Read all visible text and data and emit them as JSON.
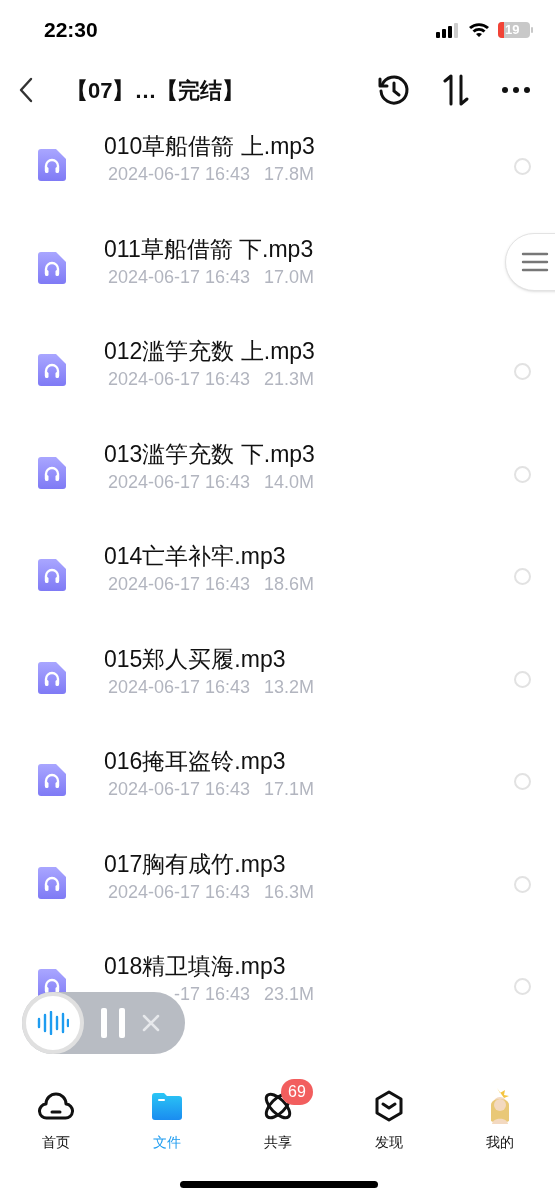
{
  "status_bar": {
    "time": "22:30",
    "battery": "19"
  },
  "header": {
    "title": "【07】…【完结】"
  },
  "files": [
    {
      "name": "010草船借箭 上.mp3",
      "date": "2024-06-17 16:43",
      "size": "17.8M",
      "selected": false
    },
    {
      "name": "011草船借箭 下.mp3",
      "date": "2024-06-17 16:43",
      "size": "17.0M"
    },
    {
      "name": "012滥竽充数 上.mp3",
      "date": "2024-06-17 16:43",
      "size": "21.3M",
      "selected": false
    },
    {
      "name": "013滥竽充数 下.mp3",
      "date": "2024-06-17 16:43",
      "size": "14.0M",
      "selected": false
    },
    {
      "name": "014亡羊补牢.mp3",
      "date": "2024-06-17 16:43",
      "size": "18.6M",
      "selected": false
    },
    {
      "name": "015郑人买履.mp3",
      "date": "2024-06-17 16:43",
      "size": "13.2M",
      "selected": false
    },
    {
      "name": "016掩耳盗铃.mp3",
      "date": "2024-06-17 16:43",
      "size": "17.1M",
      "selected": false
    },
    {
      "name": "017胸有成竹.mp3",
      "date": "2024-06-17 16:43",
      "size": "16.3M",
      "selected": false
    },
    {
      "name": "018精卫填海.mp3",
      "date": "-17 16:43",
      "size": "23.1M",
      "selected": false
    }
  ],
  "tabs": [
    {
      "label": "首页",
      "kind": "cloud",
      "selected": false
    },
    {
      "label": "文件",
      "kind": "folder",
      "selected": true
    },
    {
      "label": "共享",
      "kind": "orbit",
      "selected": false,
      "badge": "69"
    },
    {
      "label": "发现",
      "kind": "cube",
      "selected": false
    },
    {
      "label": "我的",
      "kind": "avatar",
      "selected": false
    }
  ]
}
